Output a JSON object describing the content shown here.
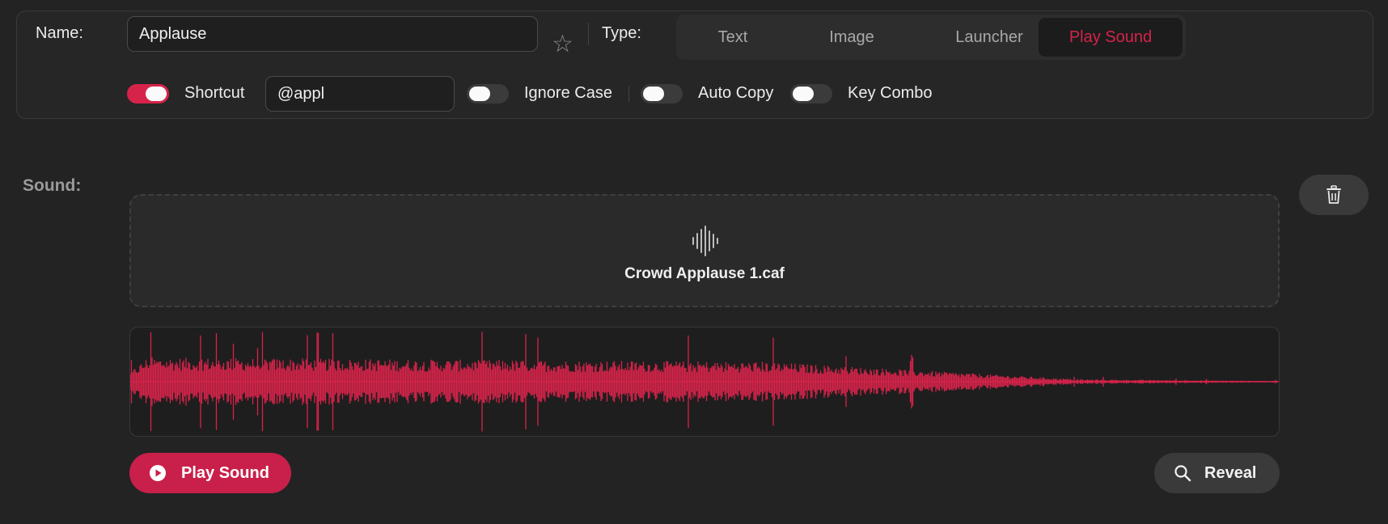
{
  "header": {
    "name_label": "Name:",
    "name_value": "Applause",
    "type_label": "Type:",
    "type_options": [
      {
        "label": "Text",
        "active": false
      },
      {
        "label": "Image",
        "active": false
      },
      {
        "label": "Launcher",
        "active": false
      },
      {
        "label": "Play Sound",
        "active": true
      }
    ]
  },
  "options": {
    "shortcut": {
      "label": "Shortcut",
      "enabled": true,
      "value": "@appl"
    },
    "ignore_case": {
      "label": "Ignore Case",
      "enabled": false
    },
    "auto_copy": {
      "label": "Auto Copy",
      "enabled": false
    },
    "key_combo": {
      "label": "Key Combo",
      "enabled": false
    }
  },
  "sound": {
    "label": "Sound:",
    "file_name": "Crowd Applause 1.caf"
  },
  "actions": {
    "play_label": "Play Sound",
    "reveal_label": "Reveal"
  },
  "colors": {
    "accent": "#d6234a",
    "waveform": "#d6234a",
    "background": "#232323"
  },
  "icons": {
    "favorite": "star-icon",
    "delete": "trash-icon",
    "file": "waveform-icon",
    "play": "play-icon",
    "reveal": "magnifier-icon"
  }
}
